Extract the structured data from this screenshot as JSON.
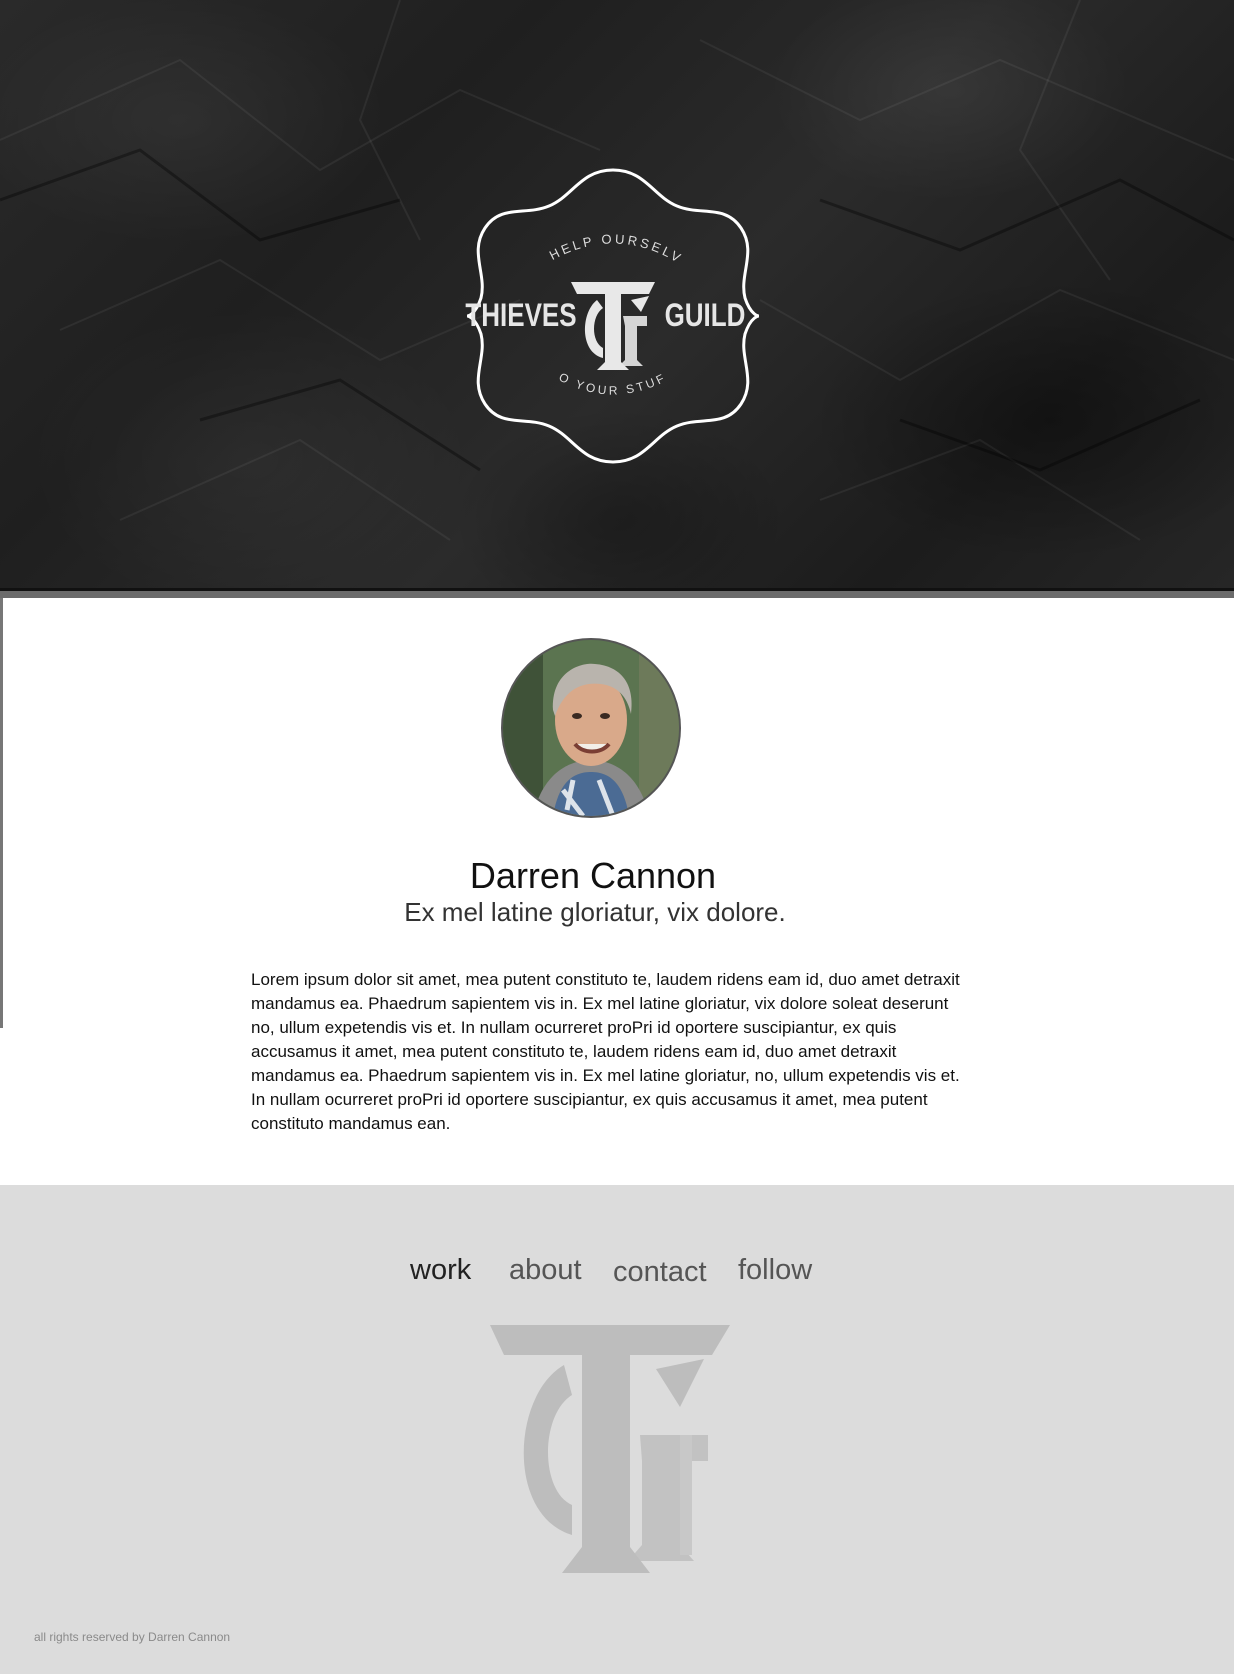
{
  "hero": {
    "logo": {
      "top_text": "TO HELP OURSELVES",
      "left_word": "THIEVES",
      "right_word": "GUILD",
      "bottom_text": "TO YOUR STUFF",
      "monogram": "TG"
    },
    "colors": {
      "background": "#232323",
      "badge_stroke": "#ffffff"
    }
  },
  "profile": {
    "name": "Darren Cannon",
    "tagline": "Ex mel latine gloriatur, vix dolore.",
    "bio": "Lorem ipsum dolor sit amet, mea putent constituto te, laudem ridens eam id, duo amet detraxit mandamus ea. Phaedrum sapientem vis in. Ex mel latine gloriatur, vix dolore soleat deserunt no, ullum expetendis vis et. In nullam ocurreret proPri id oportere suscipiantur, ex quis accusamus it amet, mea putent constituto te, laudem ridens eam id, duo amet detraxit mandamus ea. Phaedrum sapientem vis in. Ex mel latine gloriatur, no, ullum expetendis vis et. In nullam ocurreret proPri id oportere suscipiantur, ex quis accusamus it amet, mea putent constituto mandamus ean."
  },
  "footer": {
    "nav": [
      {
        "label": "work",
        "active": true
      },
      {
        "label": "about",
        "active": false
      },
      {
        "label": "contact",
        "active": false
      },
      {
        "label": "follow",
        "active": false
      }
    ],
    "monogram": "TG",
    "copyright": "all rights reserved by Darren Cannon",
    "colors": {
      "background": "#dcdcdc",
      "mark": "#bdbdbd"
    }
  }
}
